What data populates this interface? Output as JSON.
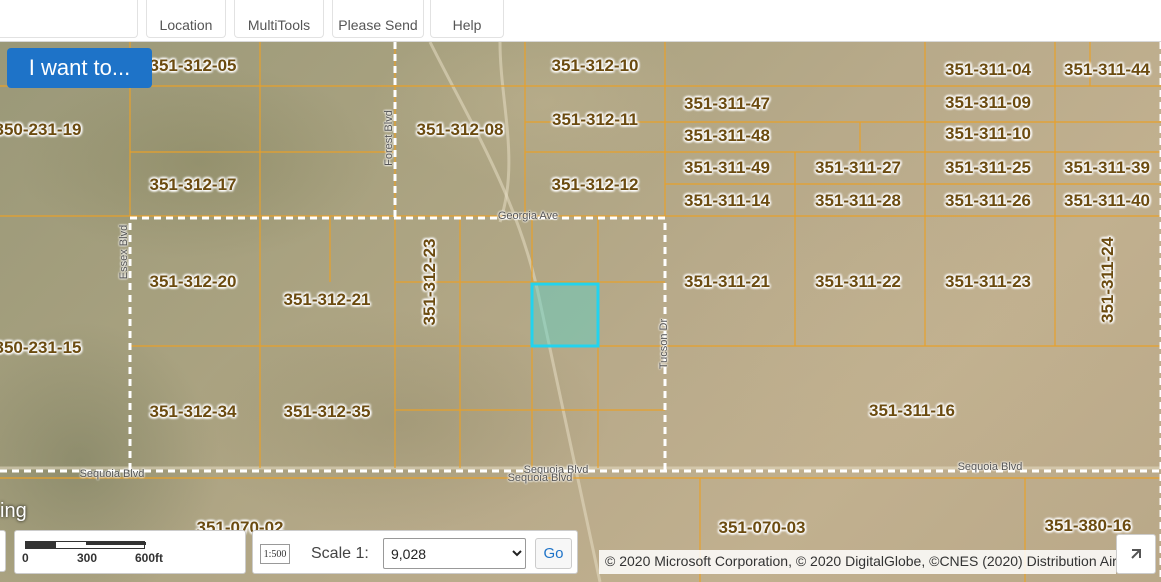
{
  "toolbar": {
    "tabs": [
      "Location",
      "MultiTools",
      "Please Send",
      "Help"
    ]
  },
  "i_want_button": "I want to...",
  "parcels": [
    {
      "label": "351-312-05",
      "orient": "h"
    },
    {
      "label": "351-312-10",
      "orient": "h"
    },
    {
      "label": "351-311-04",
      "orient": "h"
    },
    {
      "label": "351-311-44",
      "orient": "h"
    },
    {
      "label": "350-231-19",
      "orient": "h"
    },
    {
      "label": "351-312-08",
      "orient": "h"
    },
    {
      "label": "351-312-11",
      "orient": "h"
    },
    {
      "label": "351-311-47",
      "orient": "h"
    },
    {
      "label": "351-311-09",
      "orient": "h"
    },
    {
      "label": "351-311-48",
      "orient": "h"
    },
    {
      "label": "351-311-10",
      "orient": "h"
    },
    {
      "label": "351-312-17",
      "orient": "h"
    },
    {
      "label": "351-312-12",
      "orient": "h"
    },
    {
      "label": "351-311-49",
      "orient": "h"
    },
    {
      "label": "351-311-27",
      "orient": "h"
    },
    {
      "label": "351-311-25",
      "orient": "h"
    },
    {
      "label": "351-311-39",
      "orient": "h"
    },
    {
      "label": "351-311-14",
      "orient": "h"
    },
    {
      "label": "351-311-28",
      "orient": "h"
    },
    {
      "label": "351-311-26",
      "orient": "h"
    },
    {
      "label": "351-311-40",
      "orient": "h"
    },
    {
      "label": "351-312-20",
      "orient": "h"
    },
    {
      "label": "351-312-21",
      "orient": "h"
    },
    {
      "label": "351-312-23",
      "orient": "v"
    },
    {
      "label": "351-311-21",
      "orient": "h"
    },
    {
      "label": "351-311-22",
      "orient": "h"
    },
    {
      "label": "351-311-23",
      "orient": "h"
    },
    {
      "label": "351-311-24",
      "orient": "v"
    },
    {
      "label": "350-231-15",
      "orient": "h"
    },
    {
      "label": "351-312-34",
      "orient": "h"
    },
    {
      "label": "351-312-35",
      "orient": "h"
    },
    {
      "label": "351-311-16",
      "orient": "h"
    },
    {
      "label": "351-070-02",
      "orient": "h"
    },
    {
      "label": "351-070-03",
      "orient": "h"
    },
    {
      "label": "351-380-16",
      "orient": "h"
    }
  ],
  "streets": [
    {
      "label": "Forest Blvd",
      "orient": "v"
    },
    {
      "label": "Georgia Ave",
      "orient": "h"
    },
    {
      "label": "Essex Blvd",
      "orient": "v"
    },
    {
      "label": "Tucson Dr",
      "orient": "v"
    },
    {
      "label": "Sequoia Blvd",
      "orient": "h"
    },
    {
      "label": "Sequoia Blvd",
      "orient": "h"
    },
    {
      "label": "Sequoia Blvd",
      "orient": "h"
    },
    {
      "label": "Sequoia Blvd",
      "orient": "h"
    }
  ],
  "cut_label": "ing",
  "scale_bar": {
    "ticks": [
      "0",
      "300",
      "600ft"
    ]
  },
  "scale_icon": "1:500",
  "scale": {
    "label": "Scale 1:",
    "value": "9,028",
    "go": "Go"
  },
  "attribution": "© 2020 Microsoft Corporation, © 2020 DigitalGlobe, ©CNES (2020) Distribution Airbus DS",
  "colors": {
    "parcel_line": "#e8a12a",
    "selected_parcel": "#22d3ee",
    "boundary_dash": "#ffffff",
    "primary_button": "#1e73c8"
  },
  "icons": {
    "scale_icon": "ruler-scale-icon",
    "expand": "expand-arrow-icon",
    "dropdown": "chevron-down-icon"
  }
}
